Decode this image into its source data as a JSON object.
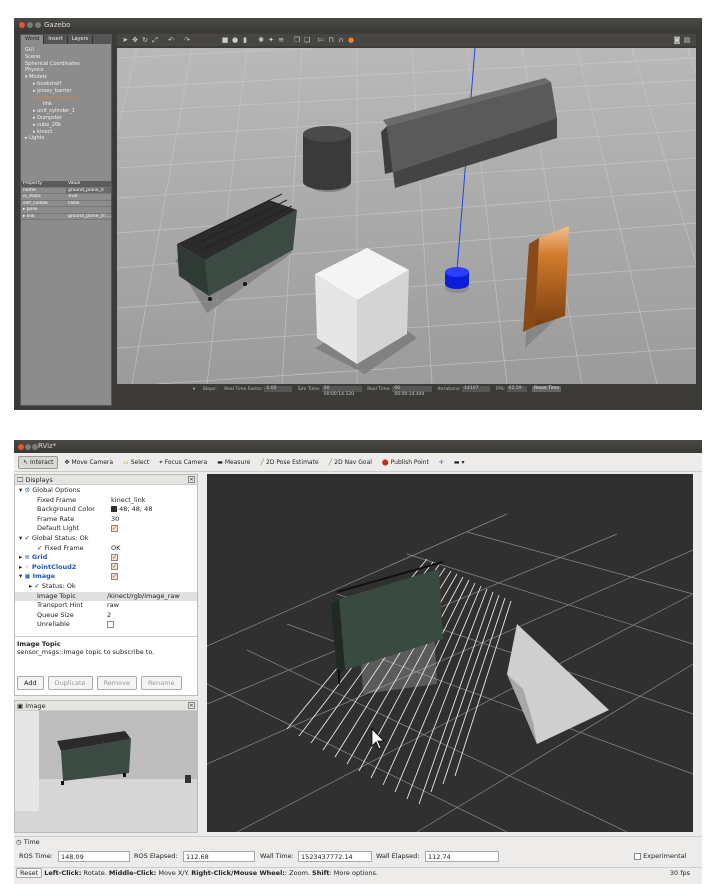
{
  "gazebo": {
    "title": "Gazebo",
    "tabs": [
      "World",
      "Insert",
      "Layers"
    ],
    "tree": [
      "GUI",
      "Scene",
      "Spherical Coordinates",
      "Physics",
      "Models",
      "bookshelf",
      "jersey_barrier",
      "ground_plane_0",
      "link",
      "unit_cylinder_1",
      "Dumpster",
      "cube_20k",
      "kinect",
      "Lights"
    ],
    "prop_header": [
      "Property",
      "Value"
    ],
    "props": [
      [
        "name",
        "ground_plane_0"
      ],
      [
        "is_static",
        "True"
      ],
      [
        "self_collide",
        "False"
      ],
      [
        "pose",
        ""
      ],
      [
        "link",
        "ground_plane_0::..."
      ]
    ],
    "status": {
      "pause": "⏸",
      "steps_label": "Steps:",
      "rtf_label": "Real Time Factor:",
      "rtf": "1.00",
      "sim_label": "Sim Time:",
      "sim": "00 00:00:14.120",
      "real_label": "Real Time:",
      "real": "00 00:00:14.444",
      "iter_label": "Iterations:",
      "iter": "14107",
      "fps_label": "FPS:",
      "fps": "62.59",
      "reset": "Reset Time"
    }
  },
  "rviz": {
    "title": "RViz*",
    "toolbar": [
      "Interact",
      "Move Camera",
      "Select",
      "Focus Camera",
      "Measure",
      "2D Pose Estimate",
      "2D Nav Goal",
      "Publish Point"
    ],
    "displays_title": "Displays",
    "rows": {
      "global_options": "Global Options",
      "fixed_frame_k": "Fixed Frame",
      "fixed_frame_v": "kinect_link",
      "bg_k": "Background Color",
      "bg_v": "48; 48; 48",
      "fr_k": "Frame Rate",
      "fr_v": "30",
      "dl_k": "Default Light",
      "gs": "Global Status: Ok",
      "gs_ff_k": "Fixed Frame",
      "gs_ff_v": "OK",
      "grid": "Grid",
      "pc2": "PointCloud2",
      "image": "Image",
      "status_ok": "Status: Ok",
      "it_k": "Image Topic",
      "it_v": "/kinect/rgb/image_raw",
      "th_k": "Transport Hint",
      "th_v": "raw",
      "qs_k": "Queue Size",
      "qs_v": "2",
      "un_k": "Unreliable"
    },
    "help_title": "Image Topic",
    "help_text": "sensor_msgs::Image topic to subscribe to.",
    "buttons": [
      "Add",
      "Duplicate",
      "Remove",
      "Rename"
    ],
    "image_panel_title": "Image",
    "time_title": "Time",
    "ros_time_label": "ROS Time:",
    "ros_time": "148.09",
    "ros_elapsed_label": "ROS Elapsed:",
    "ros_elapsed": "112.68",
    "wall_time_label": "Wall Time:",
    "wall_time": "1523437772.14",
    "wall_elapsed_label": "Wall Elapsed:",
    "wall_elapsed": "112.74",
    "experimental": "Experimental",
    "reset": "Reset",
    "hint_b1": "Left-Click:",
    "hint_t1": " Rotate. ",
    "hint_b2": "Middle-Click:",
    "hint_t2": " Move X/Y. ",
    "hint_b3": "Right-Click/Mouse Wheel:",
    "hint_t3": ": Zoom. ",
    "hint_b4": "Shift",
    "hint_t4": ": More options.",
    "fps": "30 fps"
  }
}
